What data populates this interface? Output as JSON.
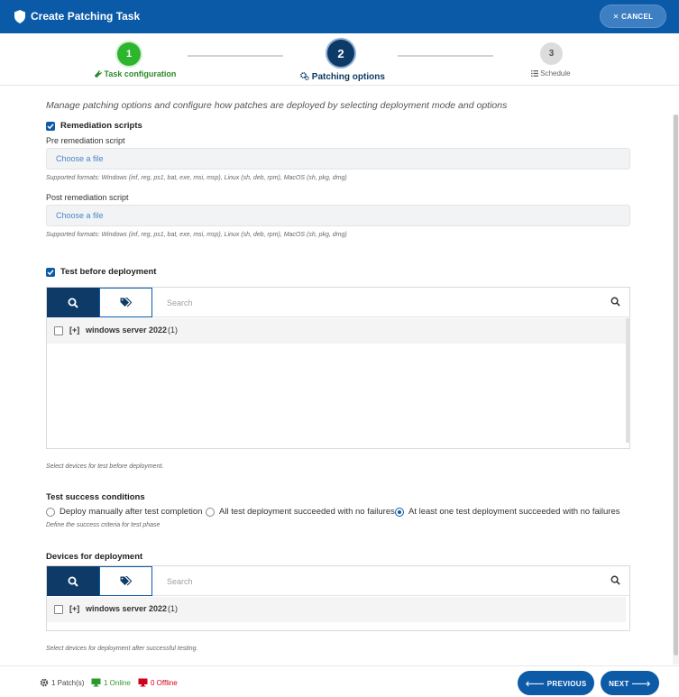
{
  "window": {
    "title": "Create Patching Task",
    "cancel_label": "✕ CANCEL"
  },
  "stepper": {
    "steps": [
      {
        "number": "1",
        "label": "Task configuration",
        "status": "complete"
      },
      {
        "number": "2",
        "label": "Patching options",
        "status": "active"
      },
      {
        "number": "3",
        "label": "Schedule",
        "status": "pending"
      }
    ]
  },
  "intro": "Manage patching options and configure how patches are deployed by selecting deployment mode and options",
  "remediation": {
    "checkbox_label": "Remediation scripts",
    "pre_label": "Pre remediation script",
    "pre_placeholder": "Choose a file",
    "pre_hint": "Supported formats: Windows (inf, reg, ps1, bat, exe, msi, msp), Linux (sh, deb, rpm), MacOS (sh, pkg, dmg)",
    "post_label": "Post remediation script",
    "post_placeholder": "Choose a file",
    "post_hint": "Supported formats: Windows (inf, reg, ps1, bat, exe, msi, msp), Linux (sh, deb, rpm), MacOS (sh, pkg, dmg)"
  },
  "test_before": {
    "checkbox_label": "Test before deployment",
    "search_placeholder": "Search",
    "rows": [
      {
        "expand": "[+]",
        "name": "windows server 2022",
        "count": "(1)"
      }
    ],
    "hint": "Select devices for test before deployment."
  },
  "test_success": {
    "title": "Test success conditions",
    "options": [
      {
        "label": "Deploy manually after test completion",
        "selected": false
      },
      {
        "label": "All test deployment succeeded with no failures",
        "selected": false
      },
      {
        "label": "At least one test deployment succeeded with no failures",
        "selected": true
      }
    ],
    "hint": "Define the success criteria for test phase"
  },
  "deployment": {
    "title": "Devices for deployment",
    "search_placeholder": "Search",
    "rows": [
      {
        "expand": "[+]",
        "name": "windows server 2022",
        "count": "(1)"
      }
    ],
    "hint": "Select devices for deployment after successful testing."
  },
  "footer": {
    "patches": "1 Patch(s)",
    "online": "1 Online",
    "offline": "0 Offline",
    "previous_label": "🡐 PREVIOUS",
    "next_label": "NEXT 🡒"
  },
  "colors": {
    "header": "#0a5aa8",
    "primary": "#0d5aa7",
    "dark": "#0d3a66",
    "success": "#2db52d",
    "danger": "#d0021b"
  },
  "icons": [
    "shield-icon",
    "wrench-icon",
    "gears-icon",
    "list-icon",
    "search-icon",
    "tags-icon",
    "gear-icon",
    "monitor-icon"
  ]
}
